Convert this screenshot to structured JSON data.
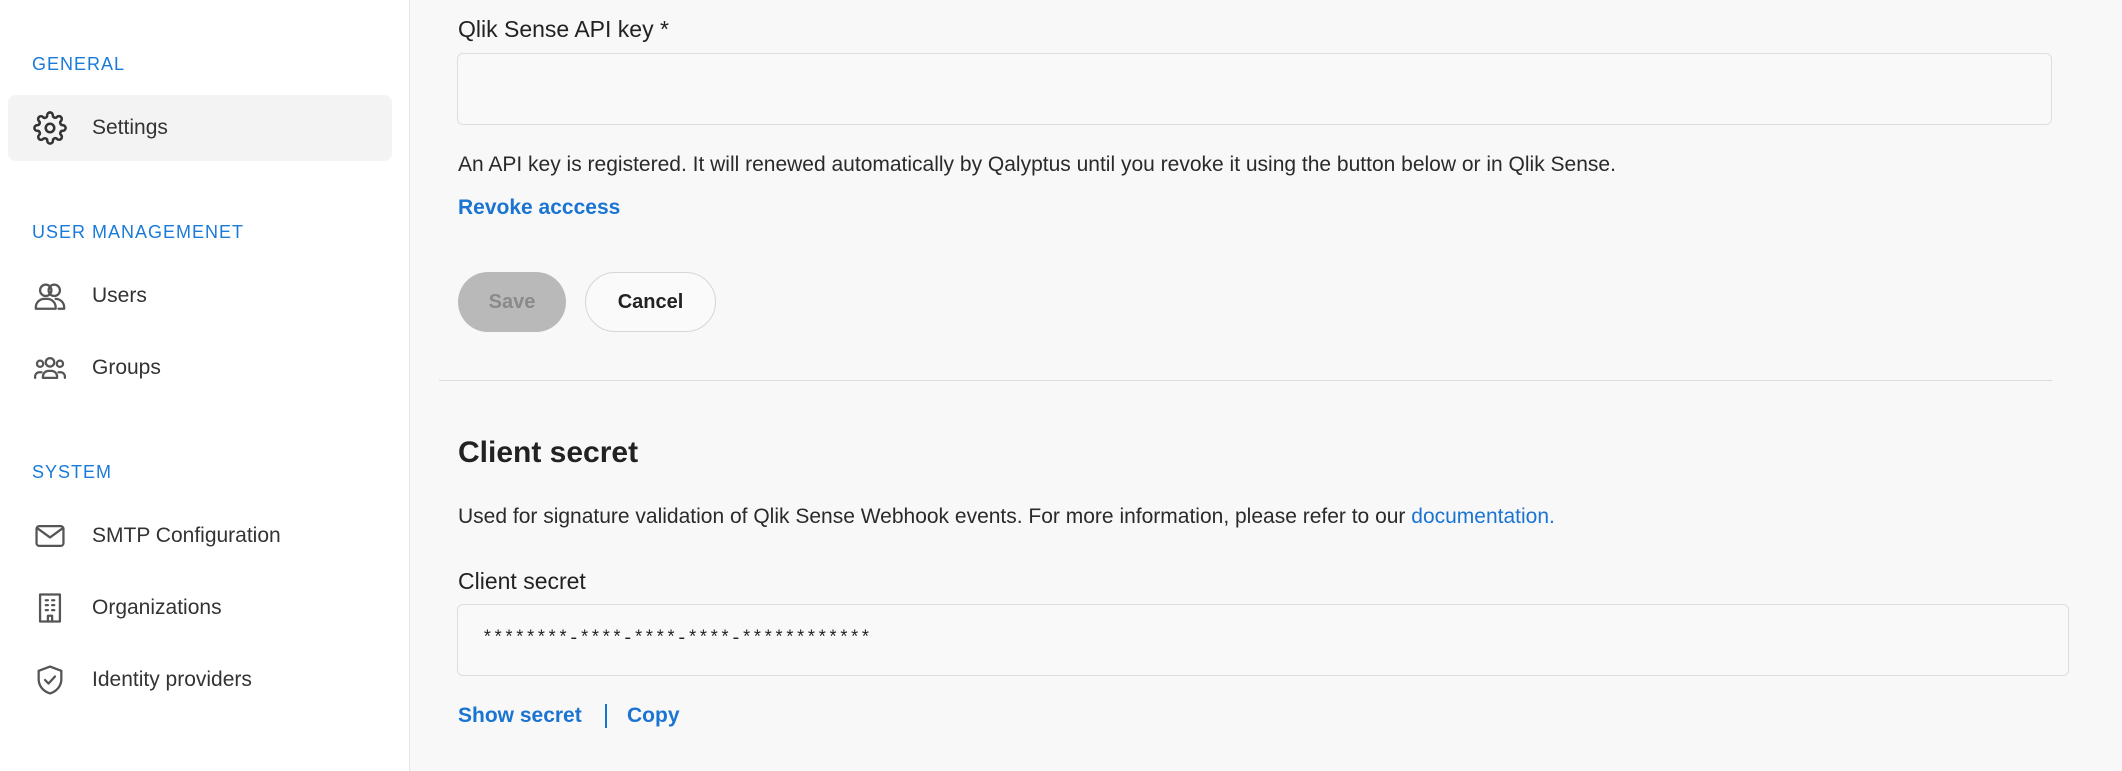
{
  "sidebar": {
    "sections": [
      {
        "title": "GENERAL",
        "items": [
          {
            "label": "Settings",
            "icon": "gear-icon",
            "active": true
          }
        ]
      },
      {
        "title": "USER MANAGEMENET",
        "items": [
          {
            "label": "Users",
            "icon": "users-icon"
          },
          {
            "label": "Groups",
            "icon": "groups-icon"
          }
        ]
      },
      {
        "title": "SYSTEM",
        "items": [
          {
            "label": "SMTP Configuration",
            "icon": "mail-icon"
          },
          {
            "label": "Organizations",
            "icon": "building-icon"
          },
          {
            "label": "Identity providers",
            "icon": "shield-icon"
          }
        ]
      }
    ]
  },
  "api_key": {
    "label": "Qlik Sense API key *",
    "value": "",
    "info": "An API key is registered. It will renewed automatically by Qalyptus until you revoke it using the button below or in Qlik Sense.",
    "revoke_label": "Revoke acccess"
  },
  "actions": {
    "save_label": "Save",
    "cancel_label": "Cancel"
  },
  "client_secret": {
    "heading": "Client secret",
    "description": "Used for signature validation of Qlik Sense Webhook events. For more information, please refer to our ",
    "doc_link": "documentation.",
    "field_label": "Client secret",
    "value": "********-****-****-****-************",
    "show_label": "Show secret",
    "copy_label": "Copy"
  },
  "colors": {
    "accent": "#1a74d2",
    "section_title": "#1a7ad9"
  }
}
